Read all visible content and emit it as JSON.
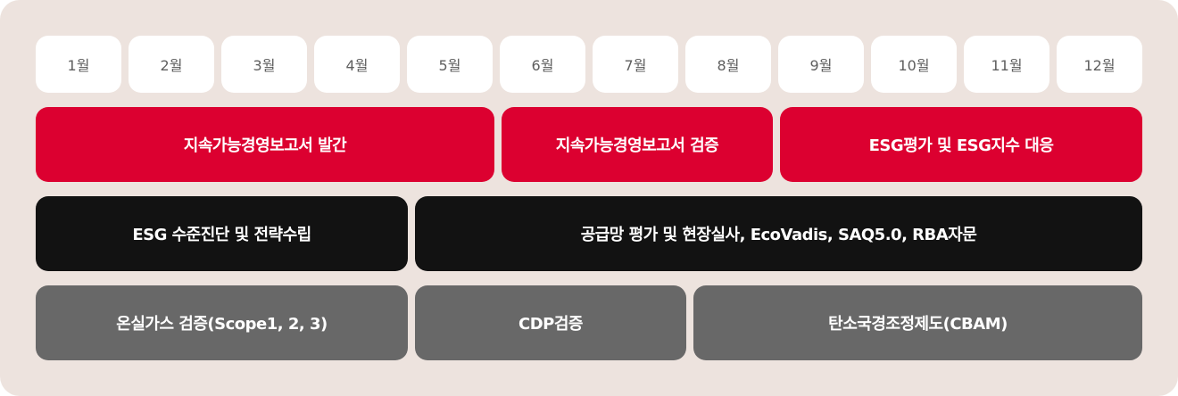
{
  "months": [
    "1월",
    "2월",
    "3월",
    "4월",
    "5월",
    "6월",
    "7월",
    "8월",
    "9월",
    "10월",
    "11월",
    "12월"
  ],
  "colors": {
    "panel_background": "#ede3de",
    "month_background": "#ffffff",
    "red": "#dc0030",
    "black": "#121212",
    "gray": "#686868"
  },
  "rows": {
    "red": [
      {
        "label": "지속가능경영보고서 발간",
        "months": "1-5월"
      },
      {
        "label": "지속가능경영보고서 검증",
        "months": "6-8월"
      },
      {
        "label": "ESG평가 및 ESG지수 대응",
        "months": "9-12월"
      }
    ],
    "black": [
      {
        "label": "ESG 수준진단 및 전략수립",
        "months": "1-4월"
      },
      {
        "label": "공급망 평가 및 현장실사, EcoVadis, SAQ5.0, RBA자문",
        "months": "5-12월"
      }
    ],
    "gray": [
      {
        "label": "온실가스 검증(Scope1, 2, 3)",
        "months": "1-4월"
      },
      {
        "label": "CDP검증",
        "months": "5-7월"
      },
      {
        "label": "탄소국경조정제도(CBAM)",
        "months": "8-12월"
      }
    ]
  }
}
